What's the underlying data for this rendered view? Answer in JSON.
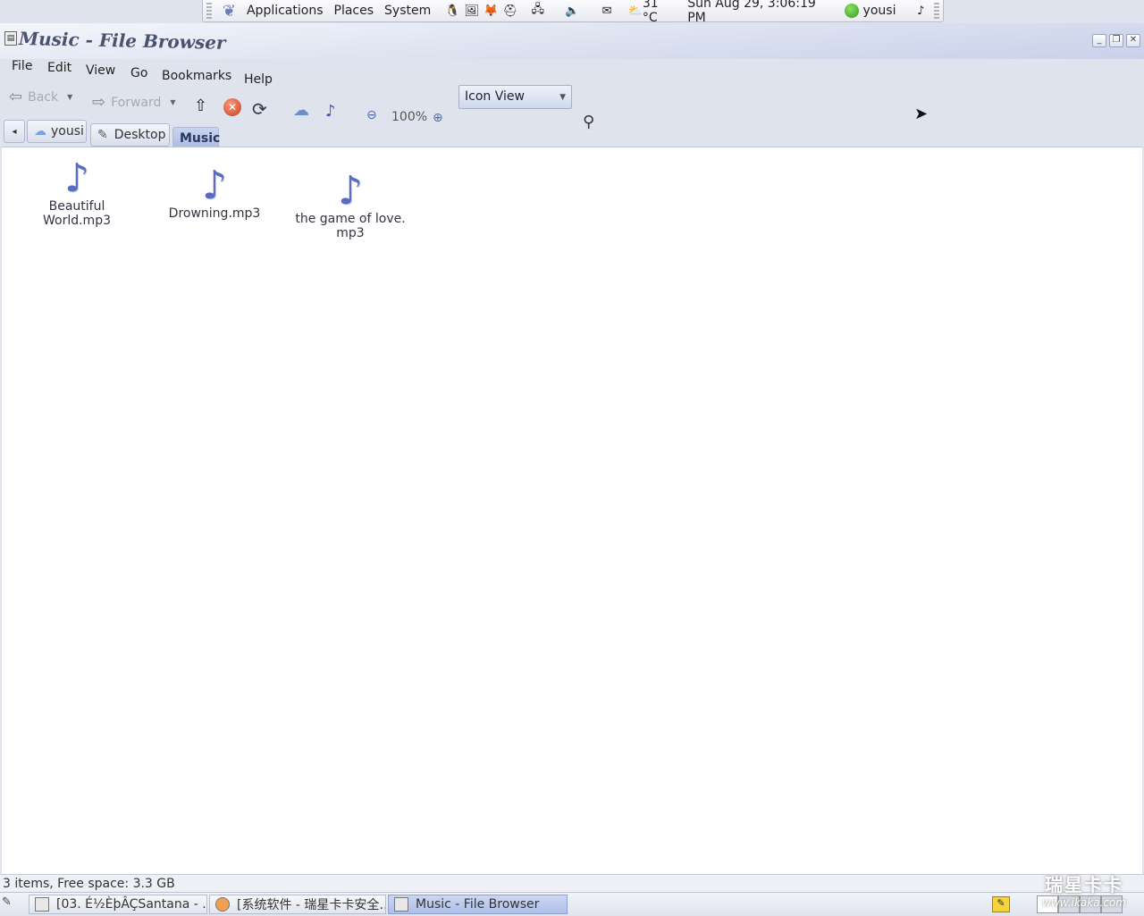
{
  "top_panel": {
    "menus": [
      "Applications",
      "Places",
      "System"
    ],
    "weather": "31 °C",
    "clock": "Sun Aug 29,  3:06:19 PM",
    "user": "yousi"
  },
  "window": {
    "title": "Music - File Browser",
    "menubar": [
      "File",
      "Edit",
      "View",
      "Go",
      "Bookmarks",
      "Help"
    ],
    "toolbar": {
      "back": "Back",
      "forward": "Forward",
      "zoom": "100%",
      "view_mode": "Icon View"
    },
    "pathbar": [
      "yousi",
      "Desktop",
      "Music"
    ],
    "files": [
      {
        "name": "Beautiful World.mp3"
      },
      {
        "name": "Drowning.mp3"
      },
      {
        "name_line1": "the game of love.",
        "name_line2": "mp3"
      }
    ],
    "status": "3 items, Free space: 3.3 GB"
  },
  "taskbar": {
    "tasks": [
      "[03. É½ÈþÂÇSantana - ...",
      "[系统软件 - 瑞星卡卡安全…",
      "Music - File Browser"
    ]
  },
  "watermark": {
    "title": "瑞星卡卡",
    "url": "www.ikaka.com"
  }
}
